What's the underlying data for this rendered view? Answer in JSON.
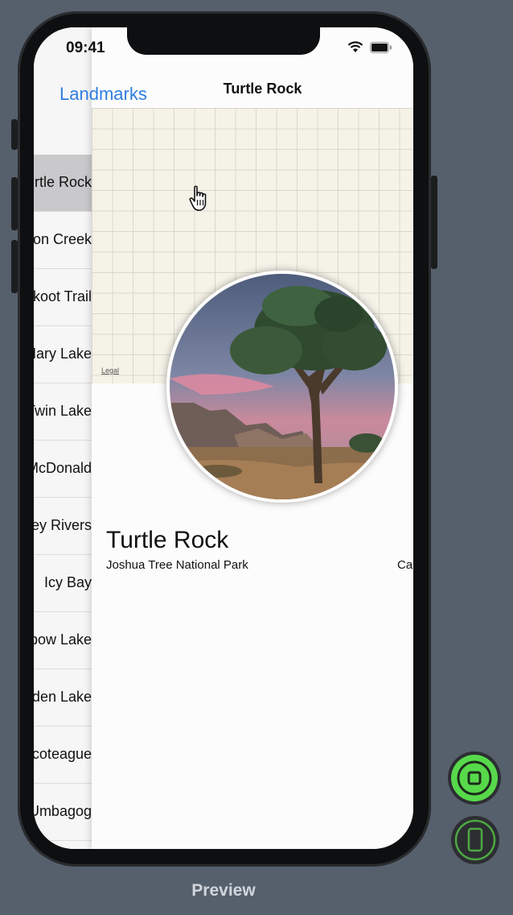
{
  "status": {
    "time": "09:41"
  },
  "list": {
    "nav_title": "Landmarks",
    "rows": [
      "Turtle Rock",
      "Silver Salmon Creek",
      "Chilkoot Trail",
      "St. Mary Lake",
      "Twin Lake",
      "Lake McDonald",
      "Charley Rivers",
      "Icy Bay",
      "Rainbow Lake",
      "Hidden Lake",
      "Chincoteague",
      "Lake Umbagog"
    ],
    "selected_index": 0
  },
  "detail": {
    "nav_title": "Turtle Rock",
    "map_legal": "Legal",
    "landmark_name": "Turtle Rock",
    "park": "Joshua Tree National Park",
    "state": "California"
  },
  "preview": {
    "label": "Preview"
  },
  "colors": {
    "accent": "#2f7de1",
    "live_green": "#57d94b",
    "device_green": "#4ea843"
  }
}
